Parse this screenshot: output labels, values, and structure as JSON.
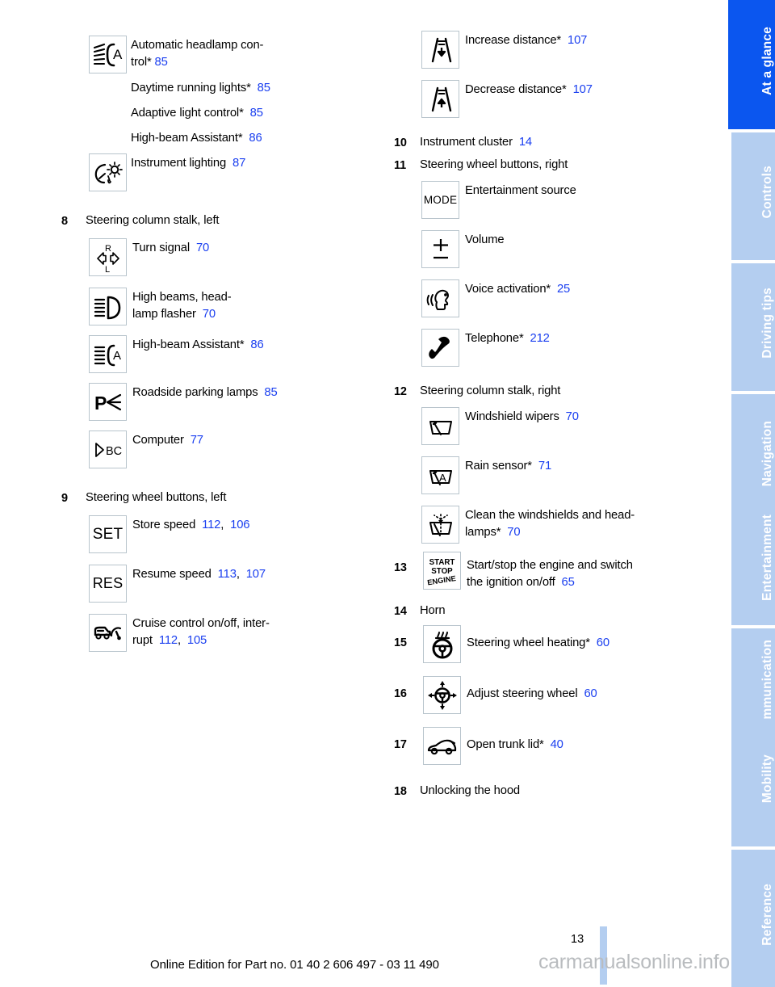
{
  "document": {
    "page_number": "13",
    "edition_line": "Online Edition for Part no. 01 40 2 606 497 - 03 11 490",
    "watermark": "carmanualsonline.info"
  },
  "colors": {
    "page_link": "#1a3ff0",
    "tab_active": "#0b56ef",
    "tab_inactive": "#b4cef0",
    "icon_border": "#b8c4cc"
  },
  "sidebar": {
    "tabs": [
      {
        "label": "At a glance",
        "active": true,
        "icon": "tab-at-a-glance"
      },
      {
        "label": "Controls",
        "active": false,
        "icon": "tab-controls"
      },
      {
        "label": "Driving tips",
        "active": false,
        "icon": "tab-driving-tips"
      },
      {
        "label": "Navigation",
        "active": false,
        "icon": "tab-navigation"
      },
      {
        "label": "Entertainment",
        "active": false,
        "icon": "tab-entertainment"
      },
      {
        "label": "Communication",
        "active": false,
        "icon": "tab-communication"
      },
      {
        "label": "Mobility",
        "active": false,
        "icon": "tab-mobility"
      },
      {
        "label": "Reference",
        "active": false,
        "icon": "tab-reference"
      }
    ]
  },
  "left_column": {
    "entries": [
      {
        "number": "",
        "icon": "automatic-headlamp-control-icon",
        "text": "Automatic headlamp con-\ntrol*",
        "line1": "Automatic headlamp con-",
        "line2": "trol*",
        "pages": [
          "85"
        ]
      },
      {
        "number": "",
        "icon": null,
        "line1": "Daytime running lights*",
        "pages": [
          "85"
        ]
      },
      {
        "number": "",
        "icon": null,
        "line1": "Adaptive light control*",
        "pages": [
          "85"
        ]
      },
      {
        "number": "",
        "icon": null,
        "line1": "High-beam Assistant*",
        "pages": [
          "86"
        ]
      },
      {
        "number": "",
        "icon": "instrument-lighting-icon",
        "line1": "Instrument lighting",
        "pages": [
          "87"
        ]
      }
    ],
    "section8": {
      "number": "8",
      "title": "Steering column stalk, left",
      "items": [
        {
          "icon": "turn-signal-icon",
          "line1": "Turn signal",
          "pages": [
            "70"
          ]
        },
        {
          "icon": "high-beams-icon",
          "line1": "High beams, head-",
          "line2": "lamp flasher",
          "pages": [
            "70"
          ]
        },
        {
          "icon": "high-beam-assistant-icon",
          "line1": "High-beam Assistant*",
          "pages": [
            "86"
          ]
        },
        {
          "icon": "roadside-parking-lamps-icon",
          "line1": "Roadside parking lamps",
          "pages": [
            "85"
          ]
        },
        {
          "icon": "computer-bc-icon",
          "line1": "Computer",
          "pages": [
            "77"
          ]
        }
      ]
    },
    "section9": {
      "number": "9",
      "title": "Steering wheel buttons, left",
      "items": [
        {
          "icon": "set-button-icon",
          "line1": "Store speed",
          "pages": [
            "112",
            "106"
          ]
        },
        {
          "icon": "res-button-icon",
          "line1": "Resume speed",
          "pages": [
            "113",
            "107"
          ]
        },
        {
          "icon": "cruise-control-icon",
          "line1": "Cruise control on/off, inter-",
          "line2": "rupt",
          "pages": [
            "112",
            "105"
          ]
        }
      ]
    }
  },
  "right_column": {
    "top_items": [
      {
        "icon": "increase-distance-icon",
        "line1": "Increase distance*",
        "pages": [
          "107"
        ]
      },
      {
        "icon": "decrease-distance-icon",
        "line1": "Decrease distance*",
        "pages": [
          "107"
        ]
      }
    ],
    "section10": {
      "number": "10",
      "title": "Instrument cluster",
      "pages": [
        "14"
      ]
    },
    "section11": {
      "number": "11",
      "title": "Steering wheel buttons, right",
      "items": [
        {
          "icon": "mode-button-icon",
          "line1": "Entertainment source",
          "pages": []
        },
        {
          "icon": "volume-button-icon",
          "line1": "Volume",
          "pages": []
        },
        {
          "icon": "voice-activation-icon",
          "line1": "Voice activation*",
          "pages": [
            "25"
          ]
        },
        {
          "icon": "telephone-icon",
          "line1": "Telephone*",
          "pages": [
            "212"
          ]
        }
      ]
    },
    "section12": {
      "number": "12",
      "title": "Steering column stalk, right",
      "items": [
        {
          "icon": "windshield-wipers-icon",
          "line1": "Windshield wipers",
          "pages": [
            "70"
          ]
        },
        {
          "icon": "rain-sensor-icon",
          "line1": "Rain sensor*",
          "pages": [
            "71"
          ]
        },
        {
          "icon": "washer-icon",
          "line1": "Clean the windshields and head-",
          "line2": "lamps*",
          "pages": [
            "70"
          ]
        }
      ]
    },
    "section13": {
      "number": "13",
      "icon": "start-stop-engine-icon",
      "line1": "Start/stop the engine and switch",
      "line2": "the ignition on/off",
      "pages": [
        "65"
      ]
    },
    "section14": {
      "number": "14",
      "title": "Horn"
    },
    "section15": {
      "number": "15",
      "icon": "steering-wheel-heating-icon",
      "line1": "Steering wheel heating*",
      "pages": [
        "60"
      ]
    },
    "section16": {
      "number": "16",
      "icon": "adjust-steering-wheel-icon",
      "line1": "Adjust steering wheel",
      "pages": [
        "60"
      ]
    },
    "section17": {
      "number": "17",
      "icon": "open-trunk-lid-icon",
      "line1": "Open trunk lid*",
      "pages": [
        "40"
      ]
    },
    "section18": {
      "number": "18",
      "title": "Unlocking the hood"
    }
  },
  "icon_text": {
    "set": "SET",
    "res": "RES",
    "mode": "MODE",
    "bc": "BC",
    "start": "START",
    "stop": "STOP",
    "engine": "ENGINE",
    "turn_r": "R",
    "turn_l": "L",
    "auto_a": "A",
    "rain_a": "A"
  }
}
